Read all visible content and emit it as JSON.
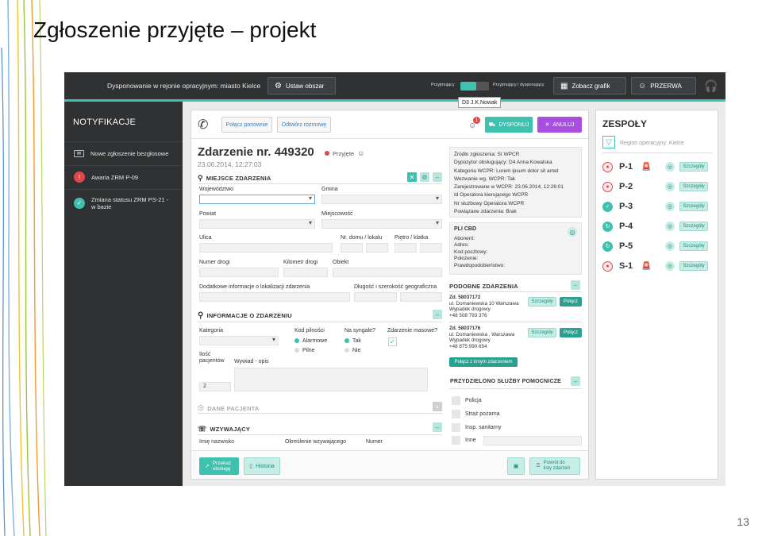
{
  "slide": {
    "title": "Zgłoszenie przyjęte – projekt",
    "page_number": "13"
  },
  "topbar": {
    "dispatch_text": "Dysponowanie w rejonie opracyjnym: miasto Kielce",
    "set_area_button": "Ustaw obszar",
    "mode_left": "Przyjmujący",
    "mode_right": "Przyjmujący i dysponujący",
    "schedule_button": "Zobacz grafik",
    "break_button": "PRZERWA"
  },
  "sidebar": {
    "title": "NOTYFIKACJE",
    "items": [
      {
        "label": "Nowe zgłoszenie bezgłosowe",
        "icon": "envelope-icon"
      },
      {
        "label": "Awaria ZRM P-09",
        "icon": "warning-icon"
      },
      {
        "label": "Zmiana statusu ZRM PS-21 - w bazie",
        "icon": "check-circle-icon"
      }
    ]
  },
  "toolbar": {
    "reconnect": "Połącz ponownie",
    "listen": "Odtwórz rozmowę",
    "user_tooltip": "D3 J.K.Nowak",
    "badge_count": "1",
    "dispatch": "DYSPONUJ",
    "cancel": "ANULUJ"
  },
  "incident": {
    "title": "Zdarzenie nr. 449320",
    "status": "Przyjęte",
    "date": "23.06.2014, 12:27:03"
  },
  "location": {
    "header": "MIEJSCE ZDARZENIA",
    "voivodeship": "Województwo",
    "commune": "Gmina",
    "county": "Powiat",
    "locality": "Miejscowość",
    "street": "Ulica",
    "house_no": "Nr. domu / lokalu",
    "floor": "Piętro / klatka",
    "road_no": "Numer drogi",
    "road_km": "Kilometr drogi",
    "object": "Obiekt",
    "extra_info": "Dodatkowe informacje o lokalizacji zdarzenia",
    "geo": "Długość i szerokość geograficzna"
  },
  "event_info": {
    "header": "INFORMACJE O ZDARZENIU",
    "category": "Kategoria",
    "urgency_label": "Kod pilności",
    "urgency_options": [
      "Alarmowe",
      "Pilne"
    ],
    "signals_label": "Na syngale?",
    "signals_options": [
      "Tak",
      "Nie"
    ],
    "mass_label": "Zdarzenie masowe?",
    "patients_label": "Ilość pacjentów",
    "patients_value": "2",
    "interview_label": "Wywiad - opis"
  },
  "patient": {
    "header": "DANE PACJENTA"
  },
  "caller": {
    "header": "WZYWAJĄCY",
    "name": "Imię nazwisko",
    "relation": "Określenie wzywającego",
    "number": "Numer"
  },
  "source": {
    "lines": [
      "Źródło zgłoszenia: SI WPCR",
      "Dypozytor obsługujący: D4 Anna Kowalska",
      "Kategoria WCPR: Lorem ipsum dolor sit amet",
      "Zarejestrowane w WCPR: 23.06.2014, 12:26:01",
      "Id Operatora kierującego WCPR",
      "Nr służbowy Operatora WCPR",
      "Powiązane zdarzenia: Brak"
    ],
    "zoom_label": "Wezwanie wg. WCPR: Tak"
  },
  "pli": {
    "header": "PLI CBD",
    "lines": [
      "Abonent:",
      "Adres:",
      "Kod pocztowy:",
      "Położenie:",
      "Prawdopodobieństwo:"
    ]
  },
  "similar": {
    "header": "PODOBNE ZDARZENIA",
    "items": [
      {
        "id": "Zd. 58037172",
        "address": "ul. Domaniewska 10 Warszawa",
        "type": "Wypadek drogowy",
        "phone": "+48 508 793 376"
      },
      {
        "id": "Zd. 58037176",
        "address": "ul. Domaniewska , Warszawa",
        "type": "Wypadek drogowy",
        "phone": "+48 875 990 654"
      }
    ],
    "details_button": "Szczegóły",
    "join_button": "Połącz",
    "join_other": "Połącz z innym zdarzeniem"
  },
  "support": {
    "header": "PRZYDZIELONO SŁUŻBY POMOCNICZE",
    "items": [
      "Policja",
      "Straż pożarna",
      "Insp. sanitarny",
      "Inne"
    ]
  },
  "bottom": {
    "handover": "Przekaż obsługę",
    "history": "Historia",
    "back": "Powrót do listy zdarzeń"
  },
  "teams": {
    "title": "ZESPOŁY",
    "region": "Region operacyjny: Kielce",
    "details_button": "Szczegóły",
    "items": [
      {
        "name": "P-1",
        "status": "alarm",
        "siren": true
      },
      {
        "name": "P-2",
        "status": "alarm",
        "siren": false
      },
      {
        "name": "P-3",
        "status": "ok",
        "siren": false
      },
      {
        "name": "P-4",
        "status": "return",
        "siren": false
      },
      {
        "name": "P-5",
        "status": "return",
        "siren": false
      },
      {
        "name": "S-1",
        "status": "alarm",
        "siren": true
      }
    ]
  },
  "colors": {
    "teal": "#3ec1ae",
    "purple": "#a84fe0",
    "red": "#e0474c",
    "dark": "#2f3133"
  }
}
